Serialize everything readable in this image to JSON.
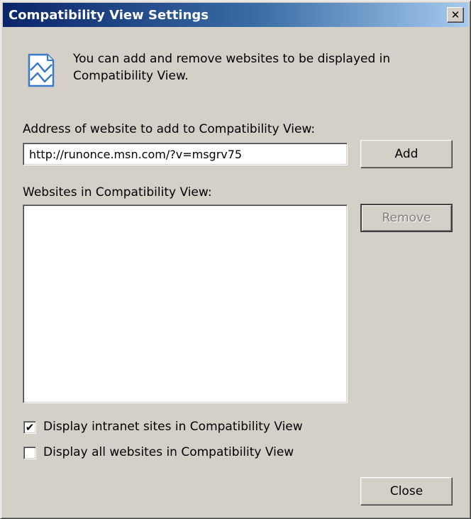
{
  "window": {
    "title": "Compatibility View Settings",
    "close_glyph": "✕"
  },
  "info": {
    "icon": "compatibility-view-icon",
    "text": "You can add and remove websites to be displayed in Compatibility View."
  },
  "address": {
    "label": "Address of website to add to Compatibility View:",
    "value": "http://runonce.msn.com/?v=msgrv75",
    "add_label": "Add"
  },
  "websites": {
    "label": "Websites in Compatibility View:",
    "items": [],
    "remove_label": "Remove"
  },
  "options": {
    "intranet": {
      "label": "Display intranet sites in Compatibility View",
      "checked": true
    },
    "all_websites": {
      "label": "Display all websites in Compatibility View",
      "checked": false
    }
  },
  "footer": {
    "close_label": "Close"
  }
}
